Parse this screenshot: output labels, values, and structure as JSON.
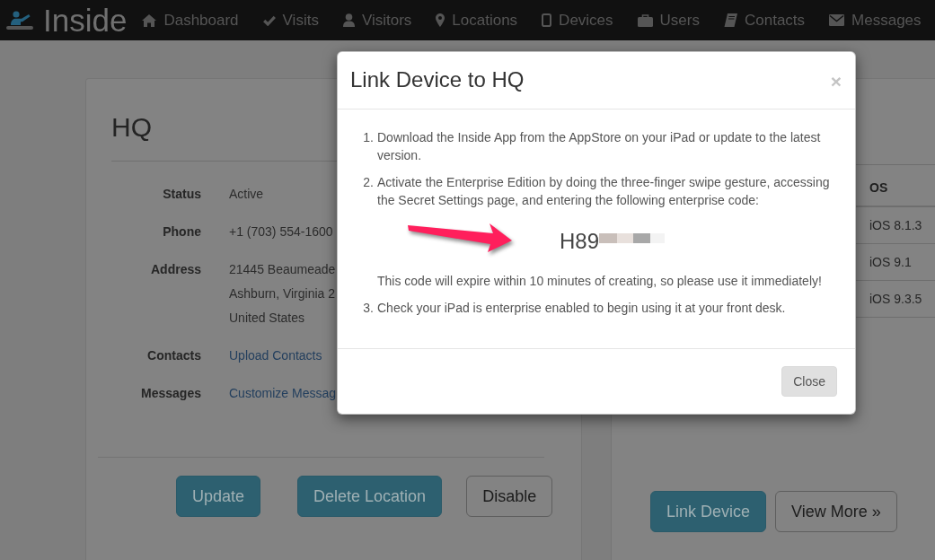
{
  "navbar": {
    "brand": "Inside",
    "items": [
      "Dashboard",
      "Visits",
      "Visitors",
      "Locations",
      "Devices",
      "Users",
      "Contacts",
      "Messages"
    ]
  },
  "location_card": {
    "title": "HQ",
    "details": [
      {
        "label": "Status",
        "kind": "text",
        "lines": [
          "Active"
        ]
      },
      {
        "label": "Phone",
        "kind": "text",
        "lines": [
          "+1 (703) 554-1600"
        ]
      },
      {
        "label": "Address",
        "kind": "text",
        "lines": [
          "21445 Beaumeade",
          "Ashburn, Virginia 2",
          "United States"
        ]
      },
      {
        "label": "Contacts",
        "kind": "link",
        "lines": [
          "Upload Contacts"
        ]
      },
      {
        "label": "Messages",
        "kind": "link",
        "lines": [
          "Customize Messag"
        ]
      }
    ],
    "buttons": [
      {
        "label": "Update",
        "kind": "primary"
      },
      {
        "label": "Delete Location",
        "kind": "primary"
      },
      {
        "label": "Disable",
        "kind": "default"
      }
    ]
  },
  "devices_card": {
    "table": {
      "columns": [
        "OS"
      ],
      "rows": [
        [
          "iOS 8.1.3"
        ],
        [
          "iOS 9.1"
        ],
        [
          "iOS 9.3.5"
        ]
      ]
    },
    "buttons": [
      {
        "label": "Link Device",
        "kind": "primary"
      },
      {
        "label": "View More »",
        "kind": "default"
      }
    ]
  },
  "modal": {
    "title": "Link Device to HQ",
    "close_symbol": "×",
    "steps": [
      {
        "number": "1.",
        "text": "Download the Inside App from the AppStore on your iPad or update to the latest version."
      },
      {
        "number": "2.",
        "text": "Activate the Enterprise Edition by doing the three-finger swipe gesture, accessing the Secret Settings page, and entering the following enterprise code:",
        "code": "H89",
        "note": "This code will expire within 10 minutes of creating, so please use it immediately!"
      },
      {
        "number": "3.",
        "text": "Check your iPad is enterprise enabled to begin using it at your front desk."
      }
    ],
    "buttons": [
      "Close"
    ]
  }
}
